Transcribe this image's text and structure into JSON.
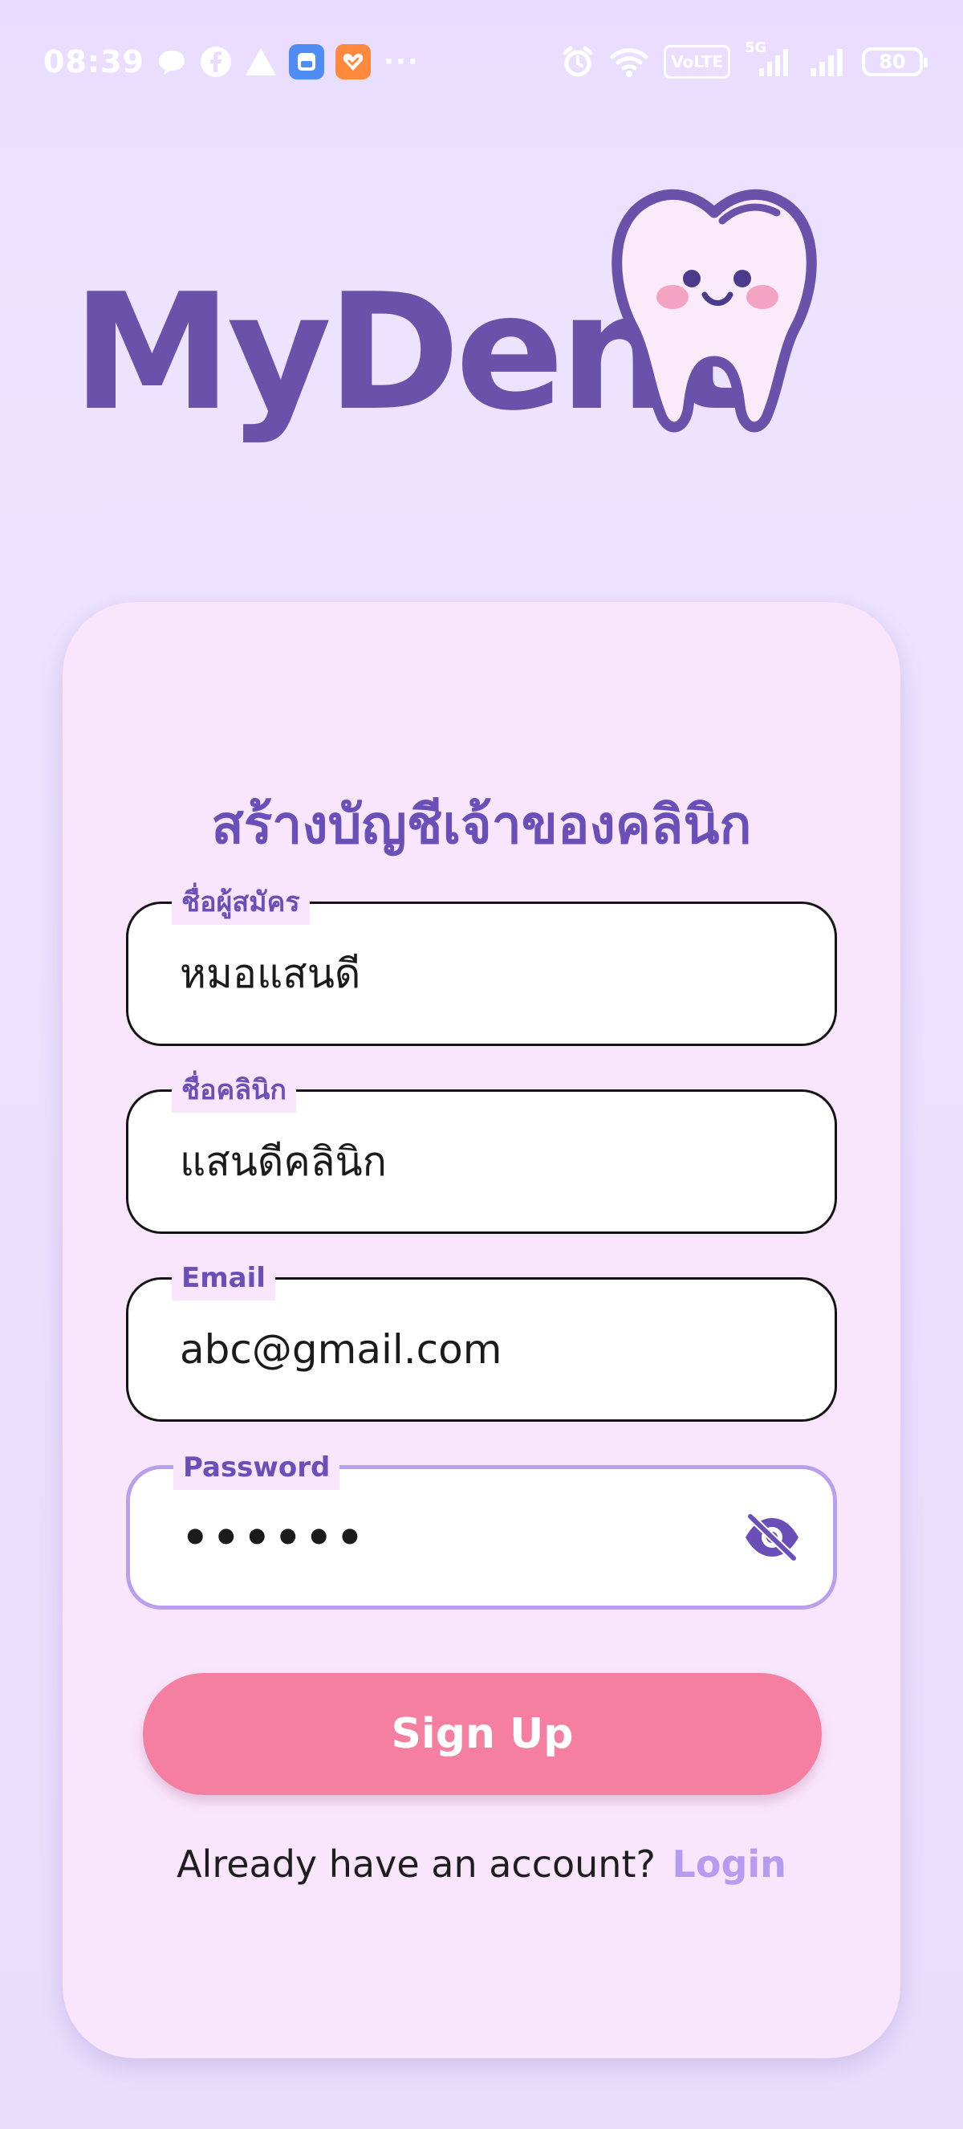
{
  "status_bar": {
    "time": "08:39",
    "more_indicator": "···",
    "network_badge": "VoLTE",
    "network_type": "5G",
    "battery_level": "80"
  },
  "logo": {
    "brand_name": "MyDent"
  },
  "form": {
    "title": "สร้างบัญชีเจ้าของคลินิก",
    "fields": [
      {
        "label": "ชื่อผู้สมัคร",
        "value": "หมอแสนดี"
      },
      {
        "label": "ชื่อคลินิก",
        "value": "แสนดีคลินิก"
      },
      {
        "label": "Email",
        "value": "abc@gmail.com"
      },
      {
        "label": "Password",
        "value": "••••••"
      }
    ],
    "password_toggle_icon": "eye-off-icon",
    "signup_label": "Sign Up",
    "login_prompt": "Already have an account?",
    "login_link": "Login"
  },
  "colors": {
    "background": "#ebdfff",
    "card": "#f9e6fd",
    "primary_purple": "#6a4fb8",
    "signup_pink": "#f47fa0",
    "login_link": "#b79bf0",
    "focused_border": "#b9a0ec"
  }
}
